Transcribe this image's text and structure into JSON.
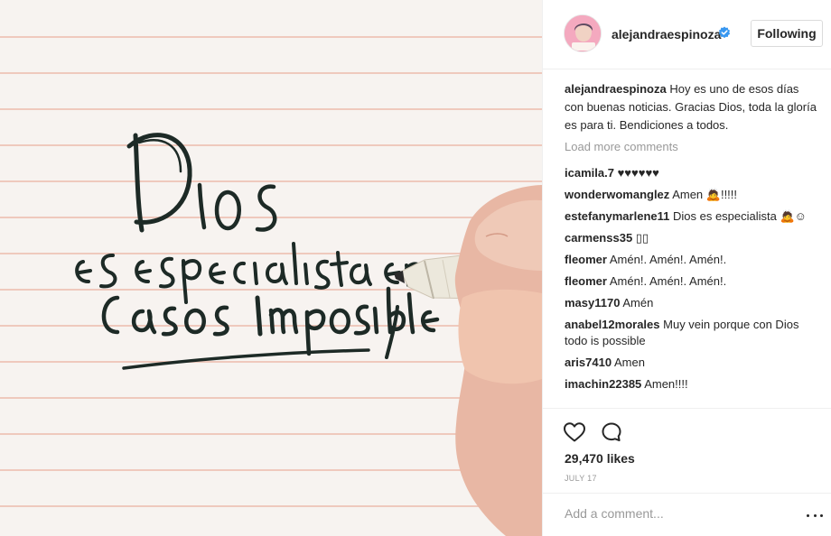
{
  "header": {
    "username": "alejandraespinoza",
    "follow_label": "Following"
  },
  "caption": {
    "username": "alejandraespinoza",
    "text": "Hoy es uno de esos días con buenas noticias. Gracias Dios, toda la gloría es para ti. Bendiciones a todos."
  },
  "load_more": "Load more comments",
  "comments": [
    {
      "user": "icamila.7",
      "text": "♥♥♥♥♥♥"
    },
    {
      "user": "wonderwomanglez",
      "text": "Amen 🙇!!!!!"
    },
    {
      "user": "estefanymarlene11",
      "text": "Dios es especialista 🙇☺"
    },
    {
      "user": "carmenss35",
      "text": "▯▯"
    },
    {
      "user": "fleomer",
      "text": "Amén!. Amén!. Amén!."
    },
    {
      "user": "fleomer",
      "text": "Amén!. Amén!. Amén!."
    },
    {
      "user": "masy1170",
      "text": "Amén"
    },
    {
      "user": "anabel12morales",
      "text": "Muy vein porque con Dios todo is possible"
    },
    {
      "user": "aris7410",
      "text": "Amen"
    },
    {
      "user": "imachin22385",
      "text": "Amen!!!!"
    }
  ],
  "likes": "29,470 likes",
  "date": "JULY 17",
  "add_comment_placeholder": "Add a comment...",
  "icons": {
    "like": "heart-outline-icon",
    "comment": "comment-bubble-icon",
    "verified": "verified-badge-icon",
    "more": "more-options-icon"
  },
  "colors": {
    "verified": "#3897f0",
    "muted": "#999999",
    "text": "#262626"
  }
}
